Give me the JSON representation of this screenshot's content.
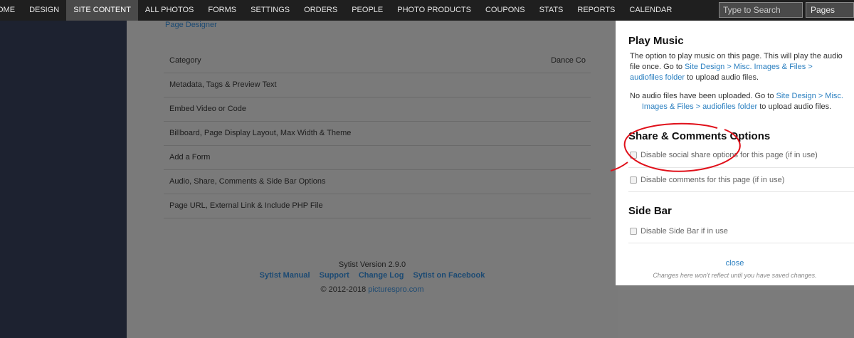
{
  "nav": {
    "items": [
      "OME",
      "DESIGN",
      "SITE CONTENT",
      "ALL PHOTOS",
      "FORMS",
      "SETTINGS",
      "ORDERS",
      "PEOPLE",
      "PHOTO PRODUCTS",
      "COUPONS",
      "STATS",
      "REPORTS",
      "CALENDAR"
    ],
    "active": "SITE CONTENT",
    "search_placeholder": "Type to Search",
    "pages_select": "Pages"
  },
  "main": {
    "page_designer": "Page Designer",
    "options": [
      {
        "label": "Category",
        "value": "Dance Co"
      },
      {
        "label": "Metadata, Tags & Preview Text"
      },
      {
        "label": "Embed Video or Code"
      },
      {
        "label": "Billboard, Page Display Layout, Max Width & Theme"
      },
      {
        "label": "Add a Form"
      },
      {
        "label": "Audio, Share, Comments & Side Bar Options"
      },
      {
        "label": "Page URL, External Link & Include PHP File"
      }
    ]
  },
  "footer": {
    "version": "Sytist Version 2.9.0",
    "links": [
      "Sytist Manual",
      "Support",
      "Change Log",
      "Sytist on Facebook"
    ],
    "copyright_prefix": "© 2012-2018 ",
    "copyright_site": "picturespro.com"
  },
  "panel": {
    "music_title": "Play Music",
    "music_text_1": "The option to play music on this page. This will play the audio file once. Go to ",
    "music_link": "Site Design > Misc. Images & Files > audiofiles folder",
    "music_text_2": " to upload audio files.",
    "noaudio_text_1": "No audio files have been uploaded. Go to ",
    "noaudio_link": "Site Design > Misc. Images & Files > audiofiles folder",
    "noaudio_text_2": " to upload audio files.",
    "share_title": "Share & Comments Options",
    "disable_share": "Disable social share options for this page (if in use)",
    "disable_comments": "Disable comments for this page (if in use)",
    "side_bar_title": "Side Bar",
    "disable_side_bar": "Disable Side Bar if in use",
    "close": "close",
    "note": "Changes here won't reflect until you have saved changes."
  },
  "colors": {
    "nav_bg": "#1f1f1f",
    "sidebar_bg": "#1d2230",
    "overlay_bg": "#7a7a7a",
    "link": "#2a7fc0",
    "annotation": "#e0101a"
  }
}
